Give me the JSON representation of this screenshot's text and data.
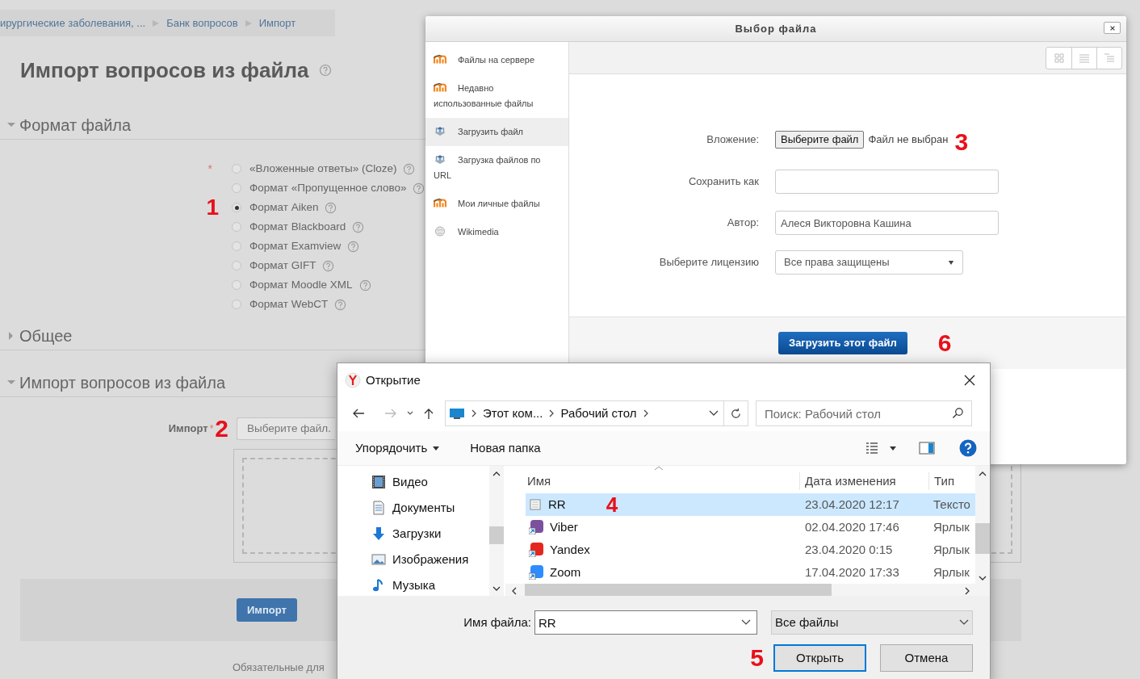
{
  "page": {
    "breadcrumb": [
      "ирургические заболевания, ...",
      "Банк вопросов",
      "Импорт"
    ],
    "title": "Импорт вопросов из файла",
    "sections": [
      {
        "title": "Формат файла",
        "expanded": true
      },
      {
        "title": "Общее",
        "expanded": false
      },
      {
        "title": "Импорт вопросов из файла",
        "expanded": true
      }
    ],
    "formats": [
      {
        "label": "«Вложенные ответы» (Cloze)",
        "selected": false
      },
      {
        "label": "Формат «Пропущенное слово»",
        "selected": false
      },
      {
        "label": "Формат Aiken",
        "selected": true
      },
      {
        "label": "Формат Blackboard",
        "selected": false
      },
      {
        "label": "Формат Examview",
        "selected": false
      },
      {
        "label": "Формат GIFT",
        "selected": false
      },
      {
        "label": "Формат Moodle XML",
        "selected": false
      },
      {
        "label": "Формат WebCT",
        "selected": false
      }
    ],
    "format_marker": "1",
    "format_required_mark": "*",
    "import_required_mark": "*",
    "import_label": "Импорт",
    "import_marker": "2",
    "choose_button": "Выберите файл.",
    "submit_button": "Импорт",
    "footnote": "Обязательные для"
  },
  "file_picker": {
    "title": "Выбор файла",
    "sidebar": [
      {
        "label": "Файлы на сервере",
        "kind": "moodle",
        "selected": false
      },
      {
        "label": "Недавно использованные файлы",
        "kind": "moodle",
        "selected": false
      },
      {
        "label": "Загрузить файл",
        "kind": "upload",
        "selected": true
      },
      {
        "label": "Загрузка файлов по URL",
        "kind": "upload",
        "selected": false
      },
      {
        "label": "Мои личные файлы",
        "kind": "moodle",
        "selected": false
      },
      {
        "label": "Wikimedia",
        "kind": "globe",
        "selected": false
      }
    ],
    "attachment_label": "Вложение:",
    "attachment_button": "Выберите файл",
    "attachment_status": "Файл не выбран",
    "attachment_marker": "3",
    "save_as_label": "Сохранить как",
    "author_label": "Автор:",
    "author_value": "Алеся Викторовна Кашина",
    "license_label": "Выберите лицензию",
    "license_value": "Все права защищены",
    "upload_button": "Загрузить этот файл",
    "upload_marker": "6"
  },
  "open_dialog": {
    "title": "Открытие",
    "path": [
      "Этот ком...",
      "Рабочий стол"
    ],
    "search_placeholder": "Поиск: Рабочий стол",
    "organize": "Упорядочить",
    "new_folder": "Новая папка",
    "nav": [
      {
        "label": "Видео",
        "kind": "video"
      },
      {
        "label": "Документы",
        "kind": "documents"
      },
      {
        "label": "Загрузки",
        "kind": "downloads"
      },
      {
        "label": "Изображения",
        "kind": "pictures"
      },
      {
        "label": "Музыка",
        "kind": "music"
      }
    ],
    "columns": [
      "Имя",
      "Дата изменения",
      "Тип"
    ],
    "rows": [
      {
        "name": "RR",
        "date": "23.04.2020 12:17",
        "type": "Тексто",
        "kind": "document",
        "selected": true
      },
      {
        "name": "Viber",
        "date": "02.04.2020 17:46",
        "type": "Ярлык",
        "kind": "shortcut",
        "color": "#7b519d",
        "selected": false
      },
      {
        "name": "Yandex",
        "date": "23.04.2020 0:15",
        "type": "Ярлык",
        "kind": "shortcut",
        "color": "#e52620",
        "selected": false
      },
      {
        "name": "Zoom",
        "date": "17.04.2020 17:33",
        "type": "Ярлык",
        "kind": "shortcut",
        "color": "#2d8cff",
        "selected": false
      }
    ],
    "row_marker": "4",
    "filename_label": "Имя файла:",
    "filename_value": "RR",
    "filter": "Все файлы",
    "open_marker": "5",
    "open_button": "Открыть",
    "cancel_button": "Отмена"
  }
}
